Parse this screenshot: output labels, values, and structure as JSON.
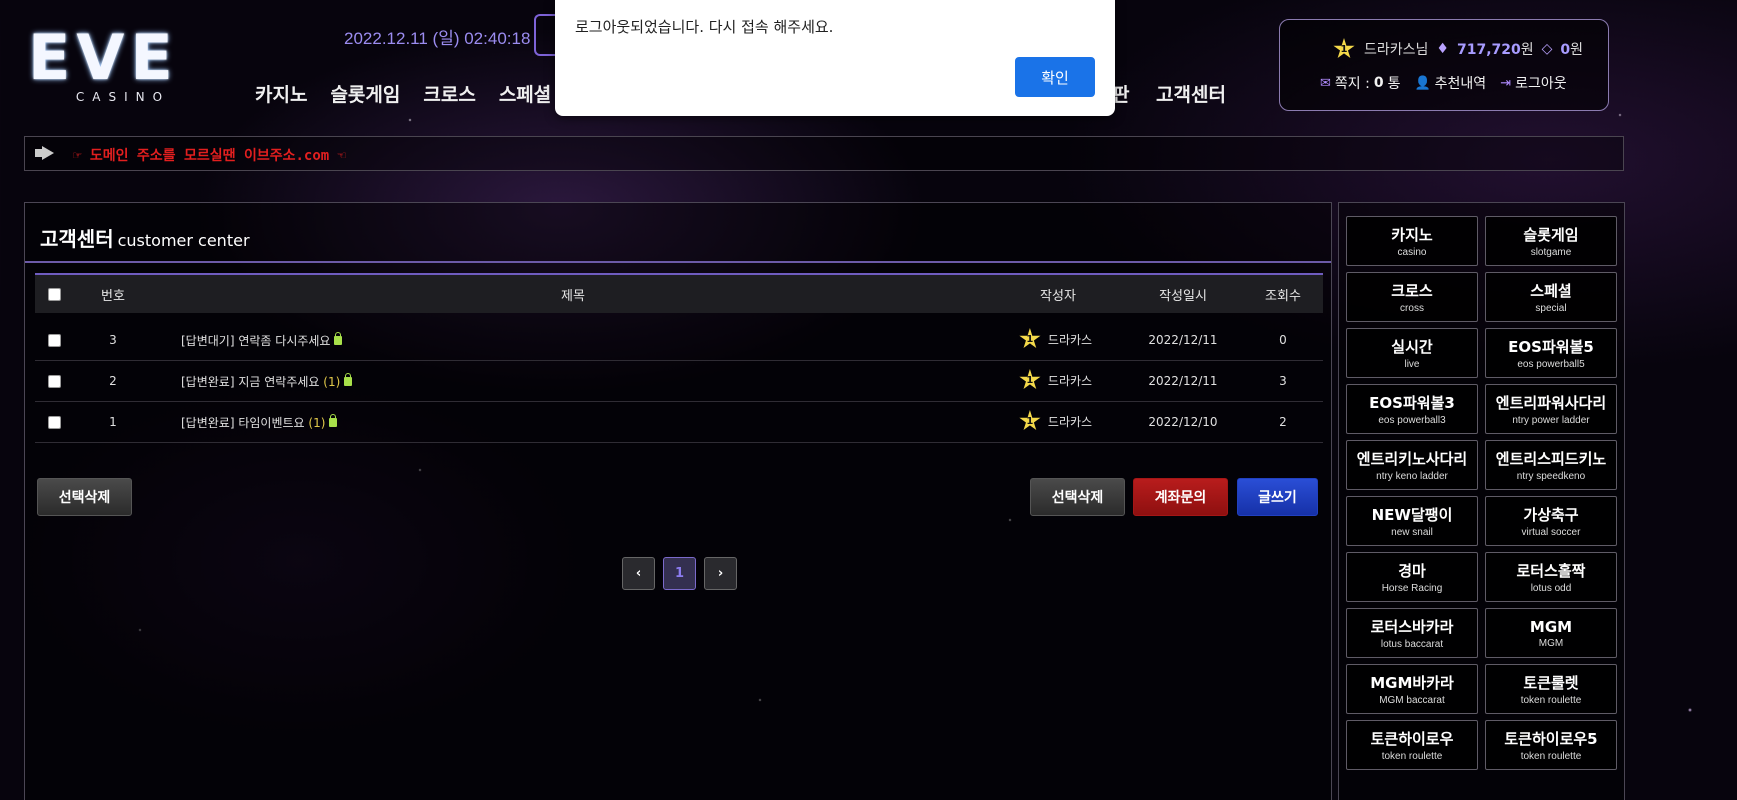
{
  "header": {
    "logo_main": "EVE",
    "logo_sub": "CASINO",
    "datetime": "2022.12.11 (일) 02:40:18",
    "nav": [
      "카지노",
      "슬롯게임",
      "크로스",
      "스페셜"
    ],
    "nav_right": [
      "판",
      "고객센터"
    ]
  },
  "user": {
    "level": "1",
    "name": "드라카스님",
    "money": "717,720",
    "money_unit": "원",
    "points": "0",
    "points_unit": "원",
    "message_label": "쪽지 :",
    "message_count": "0",
    "message_unit": "통",
    "referral_label": "추천내역",
    "logout_label": "로그아웃"
  },
  "notice": {
    "text": "☞ 도메인 주소를 모르실땐 이브주소.com ☜"
  },
  "main": {
    "title": "고객센터",
    "title_en": "customer center",
    "columns": {
      "no": "번호",
      "title": "제목",
      "author": "작성자",
      "date": "작성일시",
      "views": "조회수"
    },
    "rows": [
      {
        "no": "3",
        "title": "[답변대기] 연락좀 다시주세요",
        "comments": "",
        "level": "1",
        "author": "드라카스",
        "date": "2022/12/11",
        "views": "0"
      },
      {
        "no": "2",
        "title": "[답변완료] 지금 연락주세요",
        "comments": "(1)",
        "level": "1",
        "author": "드라카스",
        "date": "2022/12/11",
        "views": "3"
      },
      {
        "no": "1",
        "title": "[답변완료] 타임이벤트요",
        "comments": "(1)",
        "level": "1",
        "author": "드라카스",
        "date": "2022/12/10",
        "views": "2"
      }
    ],
    "buttons": {
      "delete_left": "선택삭제",
      "delete_right": "선택삭제",
      "account_inquiry": "계좌문의",
      "write": "글쓰기"
    },
    "pagination": {
      "prev": "‹",
      "current": "1",
      "next": "›"
    }
  },
  "games": [
    {
      "ko": "카지노",
      "en": "casino"
    },
    {
      "ko": "슬롯게임",
      "en": "slotgame"
    },
    {
      "ko": "크로스",
      "en": "cross"
    },
    {
      "ko": "스페셜",
      "en": "special"
    },
    {
      "ko": "실시간",
      "en": "live"
    },
    {
      "ko": "EOS파워볼5",
      "en": "eos powerball5"
    },
    {
      "ko": "EOS파워볼3",
      "en": "eos powerball3"
    },
    {
      "ko": "엔트리파워사다리",
      "en": "ntry power ladder"
    },
    {
      "ko": "엔트리키노사다리",
      "en": "ntry keno ladder"
    },
    {
      "ko": "엔트리스피드키노",
      "en": "ntry speedkeno"
    },
    {
      "ko": "NEW달팽이",
      "en": "new snail"
    },
    {
      "ko": "가상축구",
      "en": "virtual soccer"
    },
    {
      "ko": "경마",
      "en": "Horse Racing"
    },
    {
      "ko": "로터스홀짝",
      "en": "lotus odd"
    },
    {
      "ko": "로터스바카라",
      "en": "lotus baccarat"
    },
    {
      "ko": "MGM",
      "en": "MGM"
    },
    {
      "ko": "MGM바카라",
      "en": "MGM baccarat"
    },
    {
      "ko": "토큰룰렛",
      "en": "token roulette"
    },
    {
      "ko": "토큰하이로우",
      "en": "token roulette"
    },
    {
      "ko": "토큰하이로우5",
      "en": "token roulette"
    }
  ],
  "dialog": {
    "message": "로그아웃되었습니다.  다시 접속 해주세요.",
    "ok_label": "확인"
  }
}
